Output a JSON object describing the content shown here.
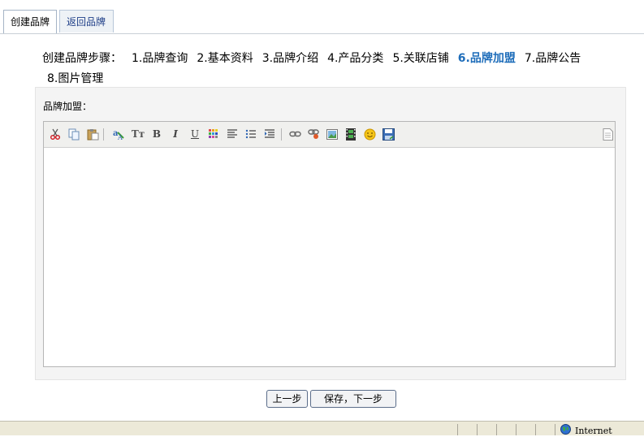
{
  "tabs": [
    {
      "label": "创建品牌",
      "active": true
    },
    {
      "label": "返回品牌",
      "active": false
    }
  ],
  "steps": {
    "prefix": "创建品牌步骤：",
    "items": [
      {
        "label": "1.品牌查询",
        "current": false
      },
      {
        "label": "2.基本资料",
        "current": false
      },
      {
        "label": "3.品牌介绍",
        "current": false
      },
      {
        "label": "4.产品分类",
        "current": false
      },
      {
        "label": "5.关联店铺",
        "current": false
      },
      {
        "label": "6.品牌加盟",
        "current": true
      },
      {
        "label": "7.品牌公告",
        "current": false
      },
      {
        "label": "8.图片管理",
        "current": false
      }
    ]
  },
  "form": {
    "field_label": "品牌加盟：",
    "editor_content": ""
  },
  "toolbar": {
    "icons": [
      "cut-icon",
      "copy-icon",
      "paste-icon",
      "format-brush-icon",
      "font-size-icon",
      "bold-icon",
      "italic-icon",
      "underline-icon",
      "text-color-icon",
      "align-icon",
      "unordered-list-icon",
      "indent-icon",
      "link-icon",
      "unlink-icon",
      "image-icon",
      "media-icon",
      "emoticon-icon",
      "save-icon",
      "source-icon"
    ],
    "bold": "B",
    "italic": "I",
    "underline": "U",
    "font_size": "Tт"
  },
  "buttons": {
    "prev": "上一步",
    "save_next": "保存，下一步"
  },
  "statusbar": {
    "zone": "Internet"
  },
  "colors": {
    "accent": "#1e6dba",
    "tab_text": "#1f3f88",
    "panel_bg": "#f4f4f4"
  }
}
